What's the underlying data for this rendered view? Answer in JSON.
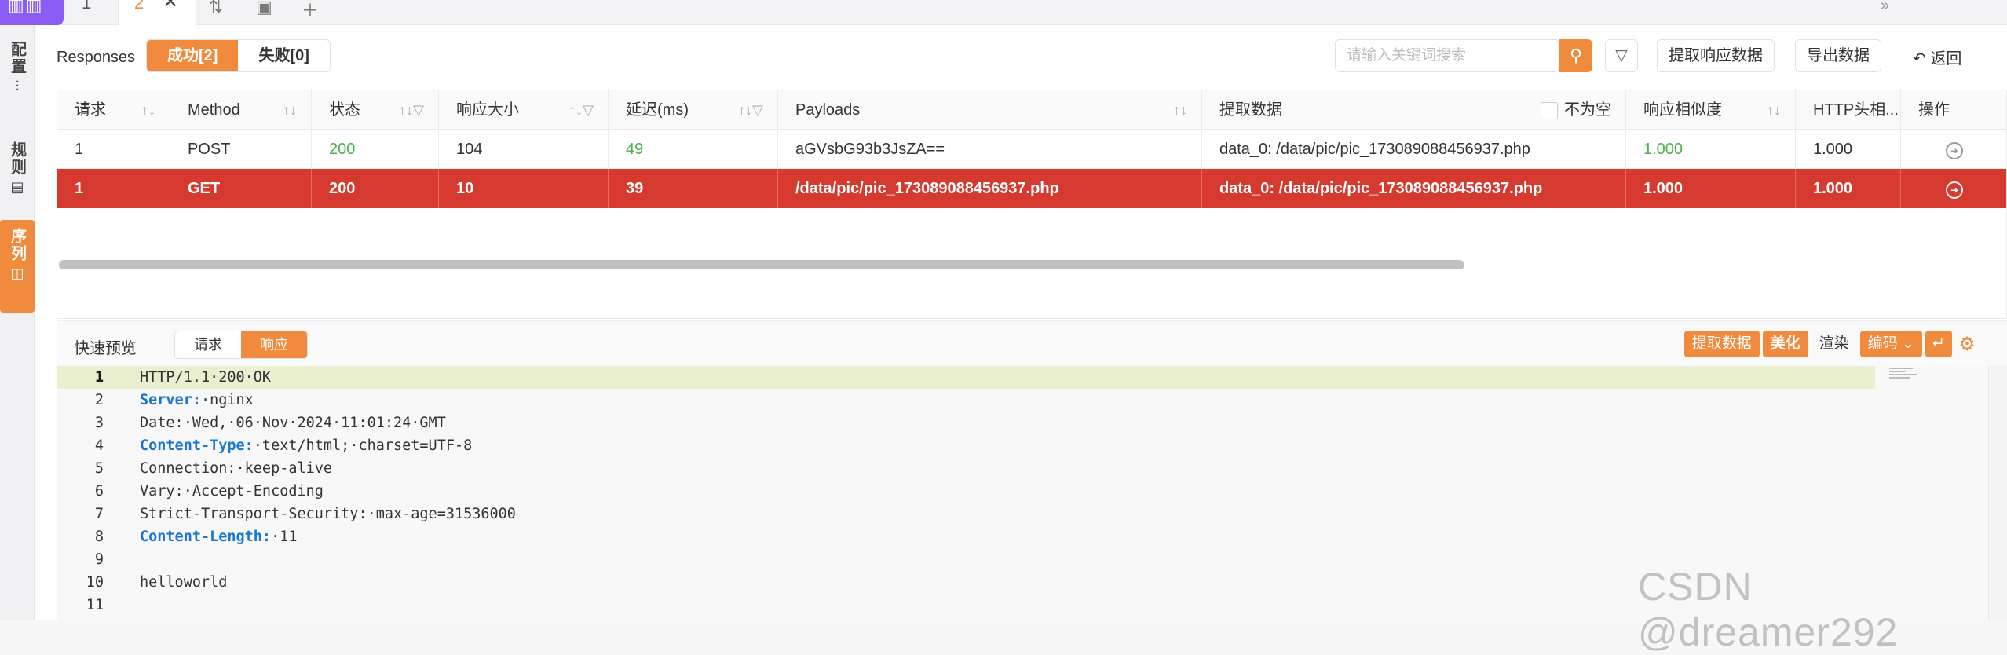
{
  "tabs": {
    "items": [
      {
        "label": "1"
      },
      {
        "label": "2"
      }
    ]
  },
  "sidebar": {
    "items": [
      {
        "label": "配置"
      },
      {
        "label": "规则"
      },
      {
        "label": "序列"
      }
    ]
  },
  "toolbar": {
    "responses_label": "Responses",
    "success_label": "成功[2]",
    "fail_label": "失败[0]",
    "search_placeholder": "请输入关键词搜索",
    "extract_response_label": "提取响应数据",
    "export_label": "导出数据",
    "back_label": "返回"
  },
  "table": {
    "columns": [
      "请求",
      "Method",
      "状态",
      "响应大小",
      "延迟(ms)",
      "Payloads",
      "提取数据",
      "响应相似度",
      "HTTP头相...",
      "操作"
    ],
    "not_empty_label": "不为空",
    "rows": [
      {
        "req": "1",
        "method": "POST",
        "status": "200",
        "size": "104",
        "delay": "49",
        "payloads": "aGVsbG93b3JsZA==",
        "extract": "data_0: /data/pic/pic_173089088456937.php",
        "similarity": "1.000",
        "header": "1.000",
        "selected": false
      },
      {
        "req": "1",
        "method": "GET",
        "status": "200",
        "size": "10",
        "delay": "39",
        "payloads": "/data/pic/pic_173089088456937.php",
        "extract": "data_0: /data/pic/pic_173089088456937.php",
        "similarity": "1.000",
        "header": "1.000",
        "selected": true
      }
    ]
  },
  "preview": {
    "title": "快速预览",
    "request_tab": "请求",
    "response_tab": "响应",
    "extract_btn": "提取数据",
    "beautify_btn": "美化",
    "render_btn": "渲染",
    "encode_btn": "编码"
  },
  "editor": {
    "lines": [
      {
        "n": "1",
        "key": "",
        "text": "HTTP/1.1·200·OK"
      },
      {
        "n": "2",
        "key": "Server:",
        "text": "·nginx"
      },
      {
        "n": "3",
        "key": "",
        "text": "Date:·Wed,·06·Nov·2024·11:01:24·GMT"
      },
      {
        "n": "4",
        "key": "Content-Type:",
        "text": "·text/html;·charset=UTF-8"
      },
      {
        "n": "5",
        "key": "",
        "text": "Connection:·keep-alive"
      },
      {
        "n": "6",
        "key": "",
        "text": "Vary:·Accept-Encoding"
      },
      {
        "n": "7",
        "key": "",
        "text": "Strict-Transport-Security:·max-age=31536000"
      },
      {
        "n": "8",
        "key": "Content-Length:",
        "text": "·11"
      },
      {
        "n": "9",
        "key": "",
        "text": ""
      },
      {
        "n": "10",
        "key": "",
        "text": "helloworld"
      },
      {
        "n": "11",
        "key": "",
        "text": ""
      }
    ]
  },
  "watermark": "CSDN @dreamer292",
  "colors": {
    "accent": "#f08a3c",
    "selected_row": "#d63a2f",
    "ok_green": "#4caf50",
    "header_key": "#1976d2",
    "tab_menu": "#8b5cf6"
  }
}
